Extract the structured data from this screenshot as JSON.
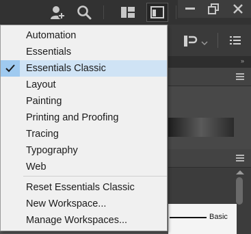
{
  "toolbar": {
    "icons": [
      "user-add-icon",
      "search-icon",
      "layout-grid-icon",
      "panel-layout-icon"
    ],
    "window_icons": [
      "minimize-icon",
      "restore-icon",
      "close-icon"
    ]
  },
  "right_panel": {
    "toolbar_icons": [
      "paragraph-align-icon",
      "chevron-down-icon",
      "list-icon"
    ],
    "stroke_label": "Basic"
  },
  "workspace_menu": {
    "items": [
      {
        "label": "Automation",
        "checked": false
      },
      {
        "label": "Essentials",
        "checked": false
      },
      {
        "label": "Essentials Classic",
        "checked": true
      },
      {
        "label": "Layout",
        "checked": false
      },
      {
        "label": "Painting",
        "checked": false
      },
      {
        "label": "Printing and Proofing",
        "checked": false
      },
      {
        "label": "Tracing",
        "checked": false
      },
      {
        "label": "Typography",
        "checked": false
      },
      {
        "label": "Web",
        "checked": false
      }
    ],
    "actions": [
      {
        "label": "Reset Essentials Classic"
      },
      {
        "label": "New Workspace..."
      },
      {
        "label": "Manage Workspaces..."
      }
    ],
    "colors": {
      "background": "#f0f0f0",
      "check_highlight": "#9fcaf0",
      "text": "#1a1a1a"
    }
  }
}
